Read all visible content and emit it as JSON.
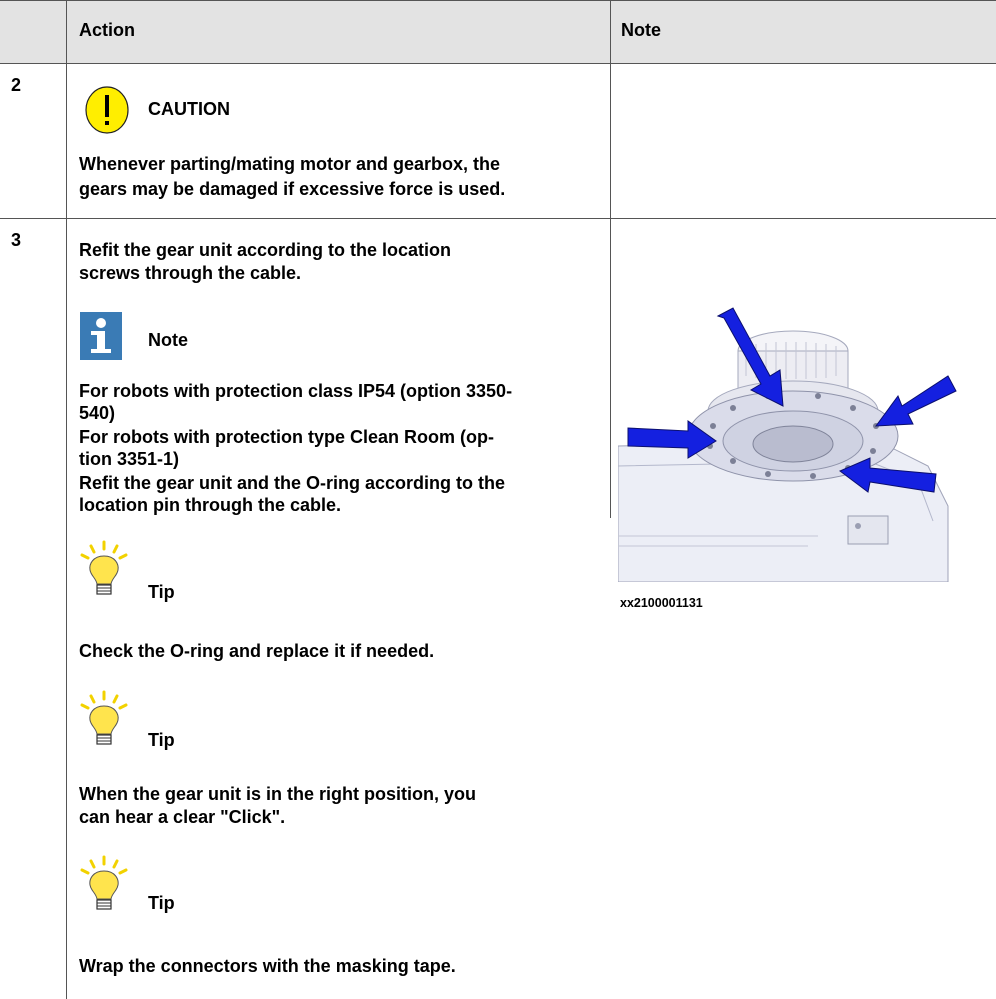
{
  "table": {
    "headers": {
      "action": "Action",
      "note": "Note"
    },
    "rows": [
      {
        "step": "2",
        "caution_title": "CAUTION",
        "caution_text_1": "Whenever parting/mating motor and gearbox, the",
        "caution_text_2": "gears may be damaged if excessive force is used."
      },
      {
        "step": "3",
        "instruction_1": "Refit the gear unit according to the location",
        "instruction_2": "screws through the cable.",
        "note_title": "Note",
        "note_line_1": "For robots with protection class IP54 (option 3350-",
        "note_line_2": "540)",
        "note_line_3": "For robots with protection type Clean Room (op-",
        "note_line_4": "tion 3351-1)",
        "note_line_5": "Refit the gear unit and the O-ring according to the",
        "note_line_6": "location pin through the cable.",
        "tip1_title": "Tip",
        "tip1_text": "Check the O-ring and replace it if needed.",
        "tip2_title": "Tip",
        "tip2_text_1": "When the gear unit is in the right position, you",
        "tip2_text_2": "can hear a clear \"Click\".",
        "tip3_title": "Tip",
        "tip3_text": "Wrap the connectors with the masking tape.",
        "figure_id": "xx2100001131"
      }
    ]
  },
  "colors": {
    "caution_yellow": "#ffee00",
    "info_blue": "#3a7bb5",
    "tip_yellow": "#ffe44d",
    "arrow_blue": "#1420e0",
    "header_gray": "#e3e3e3"
  },
  "icons": {
    "caution": "exclamation-icon",
    "note": "info-icon",
    "tip": "lightbulb-icon"
  }
}
